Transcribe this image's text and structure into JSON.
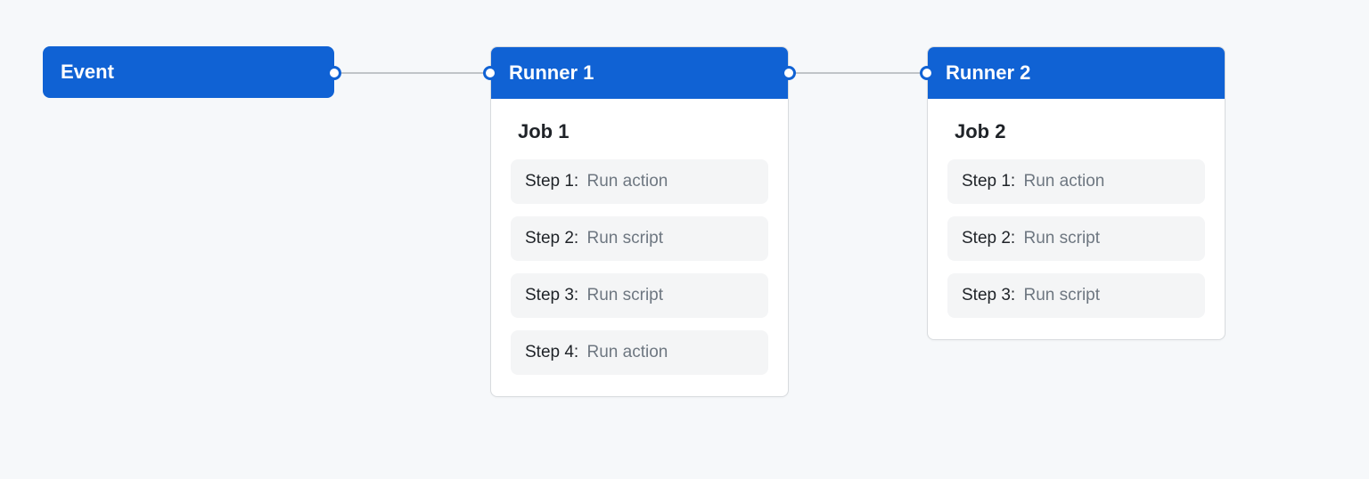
{
  "event": {
    "label": "Event"
  },
  "runners": [
    {
      "title": "Runner 1",
      "job_title": "Job 1",
      "steps": [
        {
          "label": "Step 1:",
          "action": "Run action"
        },
        {
          "label": "Step 2:",
          "action": "Run script"
        },
        {
          "label": "Step 3:",
          "action": "Run script"
        },
        {
          "label": "Step 4:",
          "action": "Run action"
        }
      ]
    },
    {
      "title": "Runner 2",
      "job_title": "Job 2",
      "steps": [
        {
          "label": "Step 1:",
          "action": "Run action"
        },
        {
          "label": "Step 2:",
          "action": "Run script"
        },
        {
          "label": "Step 3:",
          "action": "Run script"
        }
      ]
    }
  ]
}
